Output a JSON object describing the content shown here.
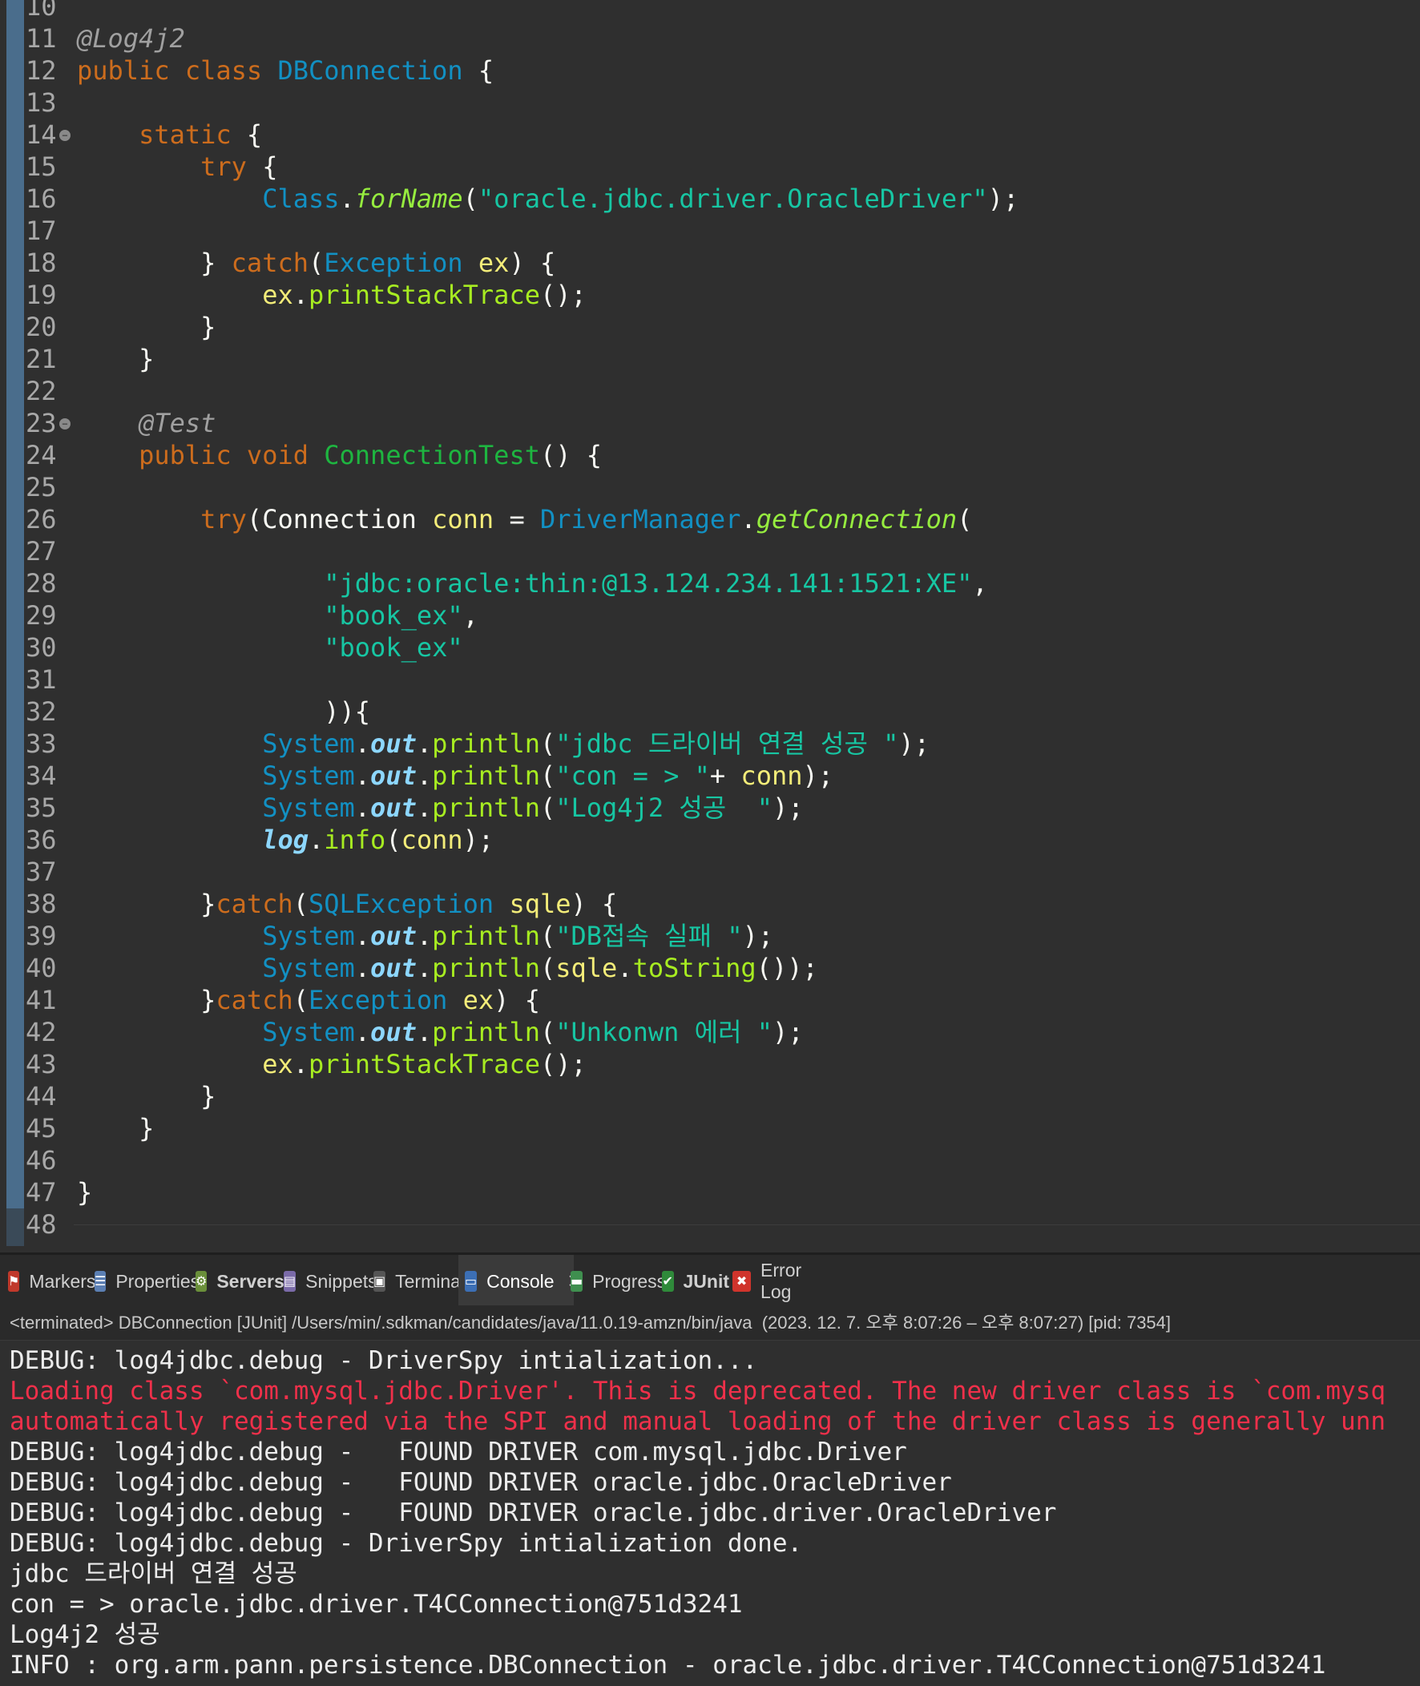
{
  "editor": {
    "lines": [
      {
        "n": "10",
        "tokens": []
      },
      {
        "n": "11",
        "tokens": [
          {
            "t": "@Log4j2",
            "c": "ann"
          }
        ]
      },
      {
        "n": "12",
        "tokens": [
          {
            "t": "public class ",
            "c": "kw"
          },
          {
            "t": "DBConnection",
            "c": "type"
          },
          {
            "t": " {",
            "c": "punct"
          }
        ]
      },
      {
        "n": "13",
        "tokens": []
      },
      {
        "n": "14",
        "fold": true,
        "tokens": [
          {
            "t": "    "
          },
          {
            "t": "static",
            "c": "kw"
          },
          {
            "t": " {",
            "c": "punct"
          }
        ]
      },
      {
        "n": "15",
        "tokens": [
          {
            "t": "        "
          },
          {
            "t": "try",
            "c": "kw"
          },
          {
            "t": " {",
            "c": "punct"
          }
        ]
      },
      {
        "n": "16",
        "tokens": [
          {
            "t": "            "
          },
          {
            "t": "Class",
            "c": "type"
          },
          {
            "t": ".",
            "c": "punct"
          },
          {
            "t": "forName",
            "c": "smeth"
          },
          {
            "t": "(",
            "c": "punct"
          },
          {
            "t": "\"oracle.jdbc.driver.OracleDriver\"",
            "c": "str"
          },
          {
            "t": ");",
            "c": "punct"
          }
        ]
      },
      {
        "n": "17",
        "tokens": []
      },
      {
        "n": "18",
        "tokens": [
          {
            "t": "        } ",
            "c": "punct"
          },
          {
            "t": "catch",
            "c": "kw"
          },
          {
            "t": "(",
            "c": "punct"
          },
          {
            "t": "Exception",
            "c": "type"
          },
          {
            "t": " "
          },
          {
            "t": "ex",
            "c": "var"
          },
          {
            "t": ") {",
            "c": "punct"
          }
        ]
      },
      {
        "n": "19",
        "tokens": [
          {
            "t": "            "
          },
          {
            "t": "ex",
            "c": "var"
          },
          {
            "t": ".",
            "c": "punct"
          },
          {
            "t": "printStackTrace",
            "c": "meth"
          },
          {
            "t": "();",
            "c": "punct"
          }
        ]
      },
      {
        "n": "20",
        "tokens": [
          {
            "t": "        }",
            "c": "punct"
          }
        ]
      },
      {
        "n": "21",
        "tokens": [
          {
            "t": "    }",
            "c": "punct"
          }
        ]
      },
      {
        "n": "22",
        "tokens": []
      },
      {
        "n": "23",
        "fold": true,
        "tokens": [
          {
            "t": "    "
          },
          {
            "t": "@Test",
            "c": "ann"
          }
        ]
      },
      {
        "n": "24",
        "tokens": [
          {
            "t": "    "
          },
          {
            "t": "public void ",
            "c": "kw"
          },
          {
            "t": "ConnectionTest",
            "c": "cls"
          },
          {
            "t": "() {",
            "c": "punct"
          }
        ]
      },
      {
        "n": "25",
        "tokens": []
      },
      {
        "n": "26",
        "tokens": [
          {
            "t": "        "
          },
          {
            "t": "try",
            "c": "kw"
          },
          {
            "t": "(",
            "c": "punct"
          },
          {
            "t": "Connection",
            "c": "punct"
          },
          {
            "t": " "
          },
          {
            "t": "conn",
            "c": "var"
          },
          {
            "t": " = ",
            "c": "punct"
          },
          {
            "t": "DriverManager",
            "c": "type"
          },
          {
            "t": ".",
            "c": "punct"
          },
          {
            "t": "getConnection",
            "c": "smeth"
          },
          {
            "t": "(",
            "c": "punct"
          }
        ]
      },
      {
        "n": "27",
        "tokens": []
      },
      {
        "n": "28",
        "tokens": [
          {
            "t": "                "
          },
          {
            "t": "\"jdbc:oracle:thin:@13.124.234.141:1521:XE\"",
            "c": "str"
          },
          {
            "t": ",",
            "c": "punct"
          }
        ]
      },
      {
        "n": "29",
        "tokens": [
          {
            "t": "                "
          },
          {
            "t": "\"book_ex\"",
            "c": "str"
          },
          {
            "t": ",",
            "c": "punct"
          }
        ]
      },
      {
        "n": "30",
        "tokens": [
          {
            "t": "                "
          },
          {
            "t": "\"book_ex\"",
            "c": "str"
          }
        ]
      },
      {
        "n": "31",
        "tokens": []
      },
      {
        "n": "32",
        "tokens": [
          {
            "t": "                )){",
            "c": "punct"
          }
        ]
      },
      {
        "n": "33",
        "tokens": [
          {
            "t": "            "
          },
          {
            "t": "System",
            "c": "type"
          },
          {
            "t": ".",
            "c": "punct"
          },
          {
            "t": "out",
            "c": "fld"
          },
          {
            "t": ".",
            "c": "punct"
          },
          {
            "t": "println",
            "c": "meth"
          },
          {
            "t": "(",
            "c": "punct"
          },
          {
            "t": "\"jdbc 드라이버 연결 성공 \"",
            "c": "str"
          },
          {
            "t": ");",
            "c": "punct"
          }
        ]
      },
      {
        "n": "34",
        "tokens": [
          {
            "t": "            "
          },
          {
            "t": "System",
            "c": "type"
          },
          {
            "t": ".",
            "c": "punct"
          },
          {
            "t": "out",
            "c": "fld"
          },
          {
            "t": ".",
            "c": "punct"
          },
          {
            "t": "println",
            "c": "meth"
          },
          {
            "t": "(",
            "c": "punct"
          },
          {
            "t": "\"con = > \"",
            "c": "str"
          },
          {
            "t": "+ ",
            "c": "punct"
          },
          {
            "t": "conn",
            "c": "var"
          },
          {
            "t": ");",
            "c": "punct"
          }
        ]
      },
      {
        "n": "35",
        "tokens": [
          {
            "t": "            "
          },
          {
            "t": "System",
            "c": "type"
          },
          {
            "t": ".",
            "c": "punct"
          },
          {
            "t": "out",
            "c": "fld"
          },
          {
            "t": ".",
            "c": "punct"
          },
          {
            "t": "println",
            "c": "meth"
          },
          {
            "t": "(",
            "c": "punct"
          },
          {
            "t": "\"Log4j2 성공  \"",
            "c": "str"
          },
          {
            "t": ");",
            "c": "punct"
          }
        ]
      },
      {
        "n": "36",
        "tokens": [
          {
            "t": "            "
          },
          {
            "t": "log",
            "c": "fld"
          },
          {
            "t": ".",
            "c": "punct"
          },
          {
            "t": "info",
            "c": "meth"
          },
          {
            "t": "(",
            "c": "punct"
          },
          {
            "t": "conn",
            "c": "var"
          },
          {
            "t": ");",
            "c": "punct"
          }
        ]
      },
      {
        "n": "37",
        "tokens": []
      },
      {
        "n": "38",
        "tokens": [
          {
            "t": "        }",
            "c": "punct"
          },
          {
            "t": "catch",
            "c": "kw"
          },
          {
            "t": "(",
            "c": "punct"
          },
          {
            "t": "SQLException",
            "c": "type"
          },
          {
            "t": " "
          },
          {
            "t": "sqle",
            "c": "var"
          },
          {
            "t": ") {",
            "c": "punct"
          }
        ]
      },
      {
        "n": "39",
        "tokens": [
          {
            "t": "            "
          },
          {
            "t": "System",
            "c": "type"
          },
          {
            "t": ".",
            "c": "punct"
          },
          {
            "t": "out",
            "c": "fld"
          },
          {
            "t": ".",
            "c": "punct"
          },
          {
            "t": "println",
            "c": "meth"
          },
          {
            "t": "(",
            "c": "punct"
          },
          {
            "t": "\"DB접속 실패 \"",
            "c": "str"
          },
          {
            "t": ");",
            "c": "punct"
          }
        ]
      },
      {
        "n": "40",
        "tokens": [
          {
            "t": "            "
          },
          {
            "t": "System",
            "c": "type"
          },
          {
            "t": ".",
            "c": "punct"
          },
          {
            "t": "out",
            "c": "fld"
          },
          {
            "t": ".",
            "c": "punct"
          },
          {
            "t": "println",
            "c": "meth"
          },
          {
            "t": "(",
            "c": "punct"
          },
          {
            "t": "sqle",
            "c": "var"
          },
          {
            "t": ".",
            "c": "punct"
          },
          {
            "t": "toString",
            "c": "meth"
          },
          {
            "t": "());",
            "c": "punct"
          }
        ]
      },
      {
        "n": "41",
        "tokens": [
          {
            "t": "        }",
            "c": "punct"
          },
          {
            "t": "catch",
            "c": "kw"
          },
          {
            "t": "(",
            "c": "punct"
          },
          {
            "t": "Exception",
            "c": "type"
          },
          {
            "t": " "
          },
          {
            "t": "ex",
            "c": "var"
          },
          {
            "t": ") {",
            "c": "punct"
          }
        ]
      },
      {
        "n": "42",
        "tokens": [
          {
            "t": "            "
          },
          {
            "t": "System",
            "c": "type"
          },
          {
            "t": ".",
            "c": "punct"
          },
          {
            "t": "out",
            "c": "fld"
          },
          {
            "t": ".",
            "c": "punct"
          },
          {
            "t": "println",
            "c": "meth"
          },
          {
            "t": "(",
            "c": "punct"
          },
          {
            "t": "\"Unkonwn 에러 \"",
            "c": "str"
          },
          {
            "t": ");",
            "c": "punct"
          }
        ]
      },
      {
        "n": "43",
        "tokens": [
          {
            "t": "            "
          },
          {
            "t": "ex",
            "c": "var"
          },
          {
            "t": ".",
            "c": "punct"
          },
          {
            "t": "printStackTrace",
            "c": "meth"
          },
          {
            "t": "();",
            "c": "punct"
          }
        ]
      },
      {
        "n": "44",
        "tokens": [
          {
            "t": "        }",
            "c": "punct"
          }
        ]
      },
      {
        "n": "45",
        "tokens": [
          {
            "t": "    }",
            "c": "punct"
          }
        ]
      },
      {
        "n": "46",
        "tokens": []
      },
      {
        "n": "47",
        "tokens": [
          {
            "t": "}",
            "c": "punct"
          }
        ]
      },
      {
        "n": "48",
        "tokens": []
      }
    ]
  },
  "tabs": [
    {
      "name": "markers",
      "label": "Markers",
      "icon": "markers-icon",
      "glyph": "⚑",
      "color": "#c0392b",
      "active": false,
      "bold": false
    },
    {
      "name": "properties",
      "label": "Properties",
      "icon": "properties-icon",
      "glyph": "☰",
      "color": "#5b7fb3",
      "active": false,
      "bold": false
    },
    {
      "name": "servers",
      "label": "Servers",
      "icon": "servers-icon",
      "glyph": "⚙",
      "color": "#6a8f3a",
      "active": false,
      "bold": true
    },
    {
      "name": "snippets",
      "label": "Snippets",
      "icon": "snippets-icon",
      "glyph": "▤",
      "color": "#7a6aa8",
      "active": false,
      "bold": false
    },
    {
      "name": "terminal",
      "label": "Terminal",
      "icon": "terminal-icon",
      "glyph": "▣",
      "color": "#555555",
      "active": false,
      "bold": false
    },
    {
      "name": "console",
      "label": "Console",
      "icon": "console-icon",
      "glyph": "▭",
      "color": "#3c6fb5",
      "active": true,
      "bold": false
    },
    {
      "name": "progress",
      "label": "Progress",
      "icon": "progress-icon",
      "glyph": "▬",
      "color": "#3f8f4f",
      "active": false,
      "bold": false
    },
    {
      "name": "junit",
      "label": "JUnit",
      "icon": "junit-icon",
      "glyph": "✔",
      "color": "#2f8a3a",
      "active": false,
      "bold": true
    },
    {
      "name": "error-log",
      "label": "Error Log",
      "icon": "error-log-icon",
      "glyph": "✖",
      "color": "#d0342c",
      "active": false,
      "bold": false
    }
  ],
  "console": {
    "status": "<terminated> DBConnection [JUnit] /Users/min/.sdkman/candidates/java/11.0.19-amzn/bin/java  (2023. 12. 7. 오후 8:07:26 – 오후 8:07:27) [pid: 7354]",
    "lines": [
      {
        "text": "DEBUG: log4jdbc.debug - DriverSpy intialization...",
        "err": false
      },
      {
        "text": "Loading class `com.mysql.jdbc.Driver'. This is deprecated. The new driver class is `com.mysq",
        "err": true
      },
      {
        "text": "automatically registered via the SPI and manual loading of the driver class is generally unn",
        "err": true
      },
      {
        "text": "DEBUG: log4jdbc.debug -   FOUND DRIVER com.mysql.jdbc.Driver",
        "err": false
      },
      {
        "text": "DEBUG: log4jdbc.debug -   FOUND DRIVER oracle.jdbc.OracleDriver",
        "err": false
      },
      {
        "text": "DEBUG: log4jdbc.debug -   FOUND DRIVER oracle.jdbc.driver.OracleDriver",
        "err": false
      },
      {
        "text": "DEBUG: log4jdbc.debug - DriverSpy intialization done.",
        "err": false
      },
      {
        "text": "jdbc 드라이버 연결 성공",
        "err": false
      },
      {
        "text": "con = > oracle.jdbc.driver.T4CConnection@751d3241",
        "err": false
      },
      {
        "text": "Log4j2 성공",
        "err": false
      },
      {
        "text": "INFO : org.arm.pann.persistence.DBConnection - oracle.jdbc.driver.T4CConnection@751d3241",
        "err": false
      }
    ]
  },
  "colors": {
    "editor_bg": "#2f2f2f",
    "keyword": "#cc6c1d",
    "type": "#1290c3",
    "string": "#17c6a3",
    "method": "#a7ec21",
    "variable": "#f3ec79",
    "error_text": "#f0304a"
  }
}
